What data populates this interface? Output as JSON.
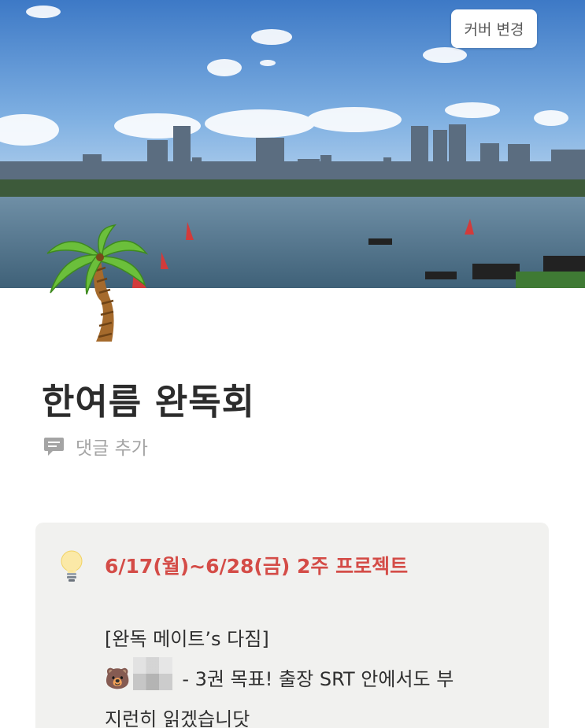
{
  "cover": {
    "change_button_label": "커버 변경"
  },
  "page": {
    "icon": "palm-tree-icon",
    "title": "한여름 완독회"
  },
  "comment": {
    "label": "댓글 추가",
    "icon": "comment-icon"
  },
  "callout": {
    "icon": "light-bulb-icon",
    "title": "6/17(월)~6/28(금) 2주 프로젝트",
    "heading": "[완독 메이트’s 다짐]",
    "entry_emoji": "🐻",
    "entry_text": "- 3권 목표! 출장 SRT 안에서도 부",
    "entry_text_cont": "지런히 읽겠습니닷"
  },
  "colors": {
    "callout_title": "#d44c47",
    "callout_bg": "#f1f1ef",
    "title_text": "#2c2c2c",
    "muted_text": "#a4a4a4"
  }
}
